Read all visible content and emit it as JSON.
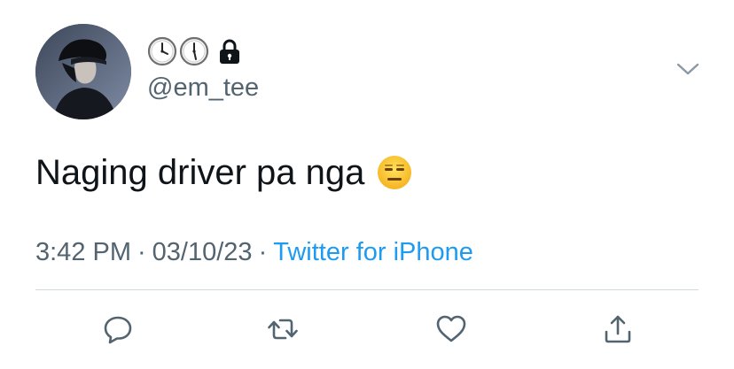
{
  "user": {
    "display_name_icons": [
      "clock-icon",
      "clock-icon",
      "lock-icon"
    ],
    "handle": "@em_tee",
    "protected": true
  },
  "tweet": {
    "text": "Naging driver pa nga",
    "emoji": "expressionless-face-emoji",
    "time": "3:42 PM",
    "date": "03/10/23",
    "separator": "·",
    "source": "Twitter for iPhone"
  },
  "actions": [
    "reply-icon",
    "retweet-icon",
    "like-icon",
    "share-icon"
  ],
  "colors": {
    "text": "#0f1419",
    "secondary": "#536471",
    "accent": "#1d9bf0",
    "divider": "#cfd9de"
  }
}
